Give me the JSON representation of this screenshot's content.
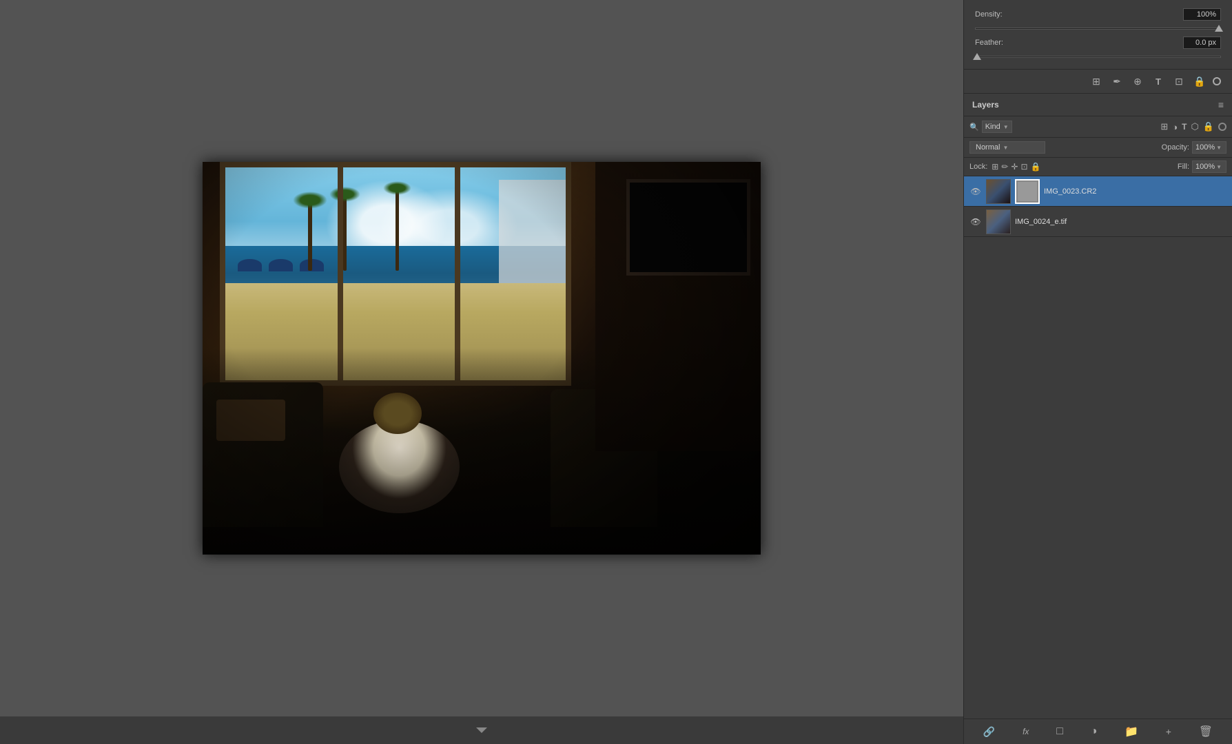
{
  "panel": {
    "density_label": "Density:",
    "density_value": "100%",
    "feather_label": "Feather:",
    "feather_value": "0.0 px",
    "layers_title": "Layers",
    "kind_label": "Kind",
    "blend_mode": "Normal",
    "opacity_label": "Opacity:",
    "opacity_value": "100%",
    "lock_label": "Lock:",
    "fill_label": "Fill:",
    "fill_value": "100%"
  },
  "layers": [
    {
      "name": "IMG_0023.CR2",
      "visible": true,
      "active": true,
      "has_mask": true
    },
    {
      "name": "IMG_0024_e.tif",
      "visible": true,
      "active": false,
      "has_mask": false
    }
  ],
  "toolbar": {
    "icons": [
      "⊞",
      "✏",
      "✛",
      "⊡",
      "🔒",
      "⭕"
    ]
  },
  "bottom_bar": {
    "icons": [
      "🔗",
      "fx",
      "□",
      "◑",
      "📁",
      "+",
      "🗑"
    ]
  }
}
